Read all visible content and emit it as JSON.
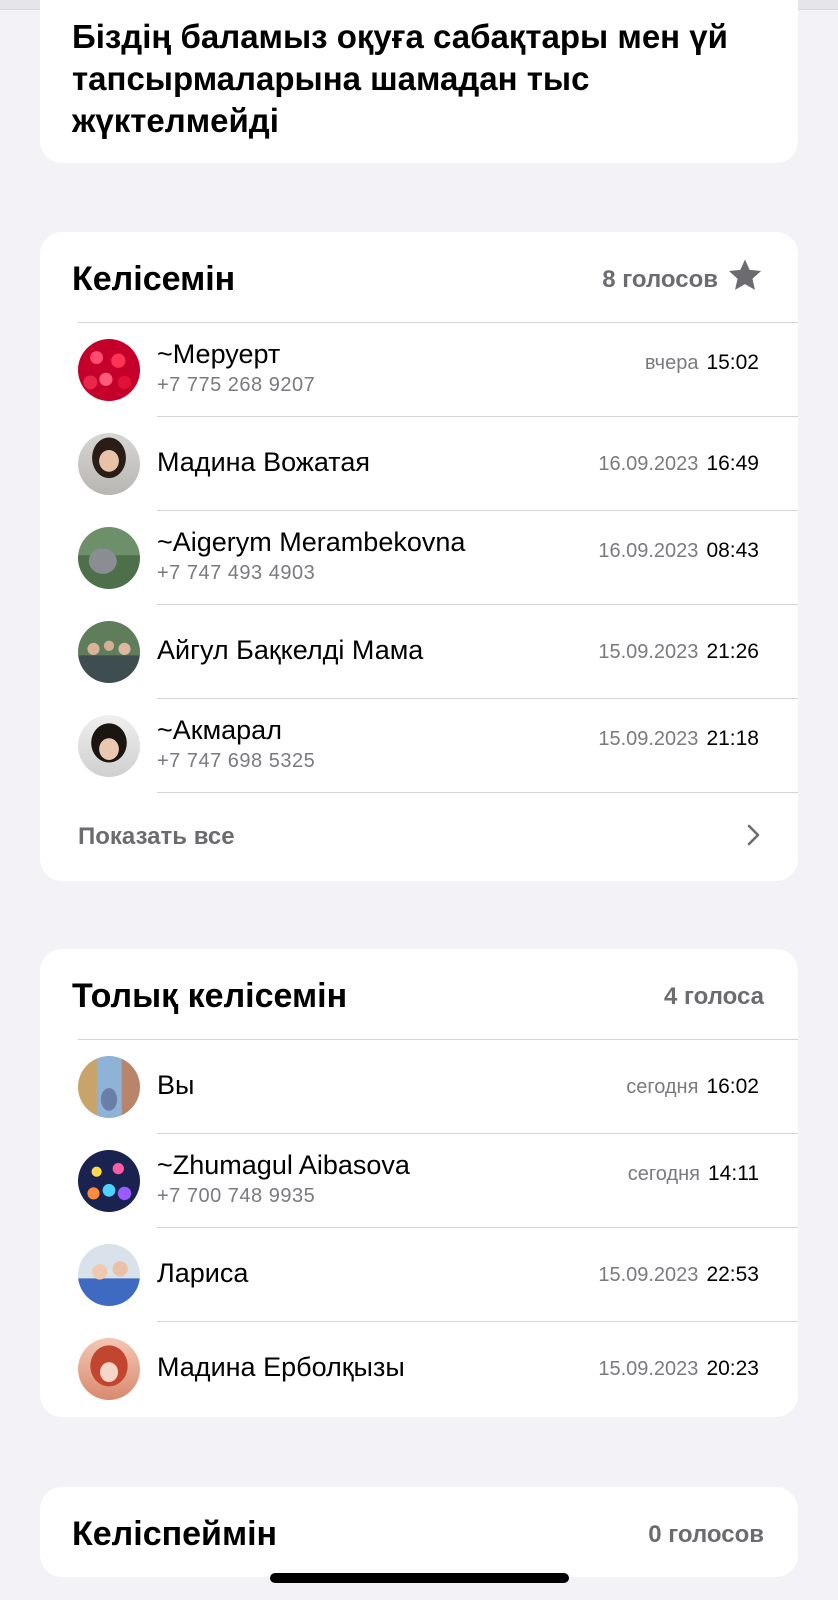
{
  "question": "Біздің баламыз оқуға сабақтары мен үй тапсырмаларына шамадан тыс жүктелмейді",
  "options": [
    {
      "title": "Келісемін",
      "count": "8 голосов",
      "starred": true,
      "voters": [
        {
          "name": "~Меруерт",
          "phone": "+7 775 268 9207",
          "date": "вчера",
          "time": "15:02",
          "avatar": "roses"
        },
        {
          "name": "Мадина Вожатая",
          "phone": "",
          "date": "16.09.2023",
          "time": "16:49",
          "avatar": "woman-portrait"
        },
        {
          "name": "~Aigerym Merambekovna",
          "phone": "+7 747 493 4903",
          "date": "16.09.2023",
          "time": "08:43",
          "avatar": "outdoor-car"
        },
        {
          "name": "Айгул Бақкелді Мама",
          "phone": "",
          "date": "15.09.2023",
          "time": "21:26",
          "avatar": "group-photo"
        },
        {
          "name": "~Акмарал",
          "phone": "+7 747 698 5325",
          "date": "15.09.2023",
          "time": "21:18",
          "avatar": "woman-selfie"
        }
      ],
      "show_all": "Показать все"
    },
    {
      "title": "Толық келісемін",
      "count": "4 голоса",
      "starred": false,
      "voters": [
        {
          "name": "Вы",
          "phone": "",
          "date": "сегодня",
          "time": "16:02",
          "avatar": "room-photo"
        },
        {
          "name": "~Zhumagul Aibasova",
          "phone": "+7 700 748 9935",
          "date": "сегодня",
          "time": "14:11",
          "avatar": "colorful-lights"
        },
        {
          "name": "Лариса",
          "phone": "",
          "date": "15.09.2023",
          "time": "22:53",
          "avatar": "mother-child"
        },
        {
          "name": "Мадина Ерболқызы",
          "phone": "",
          "date": "15.09.2023",
          "time": "20:23",
          "avatar": "anime-girl"
        }
      ]
    },
    {
      "title": "Келіспеймін",
      "count": "0 голосов",
      "starred": false,
      "voters": []
    }
  ],
  "colors": {
    "background": "#f2f2f7",
    "card": "#ffffff",
    "secondary_text": "#7a7a7f",
    "separator": "#d3d3d8"
  }
}
